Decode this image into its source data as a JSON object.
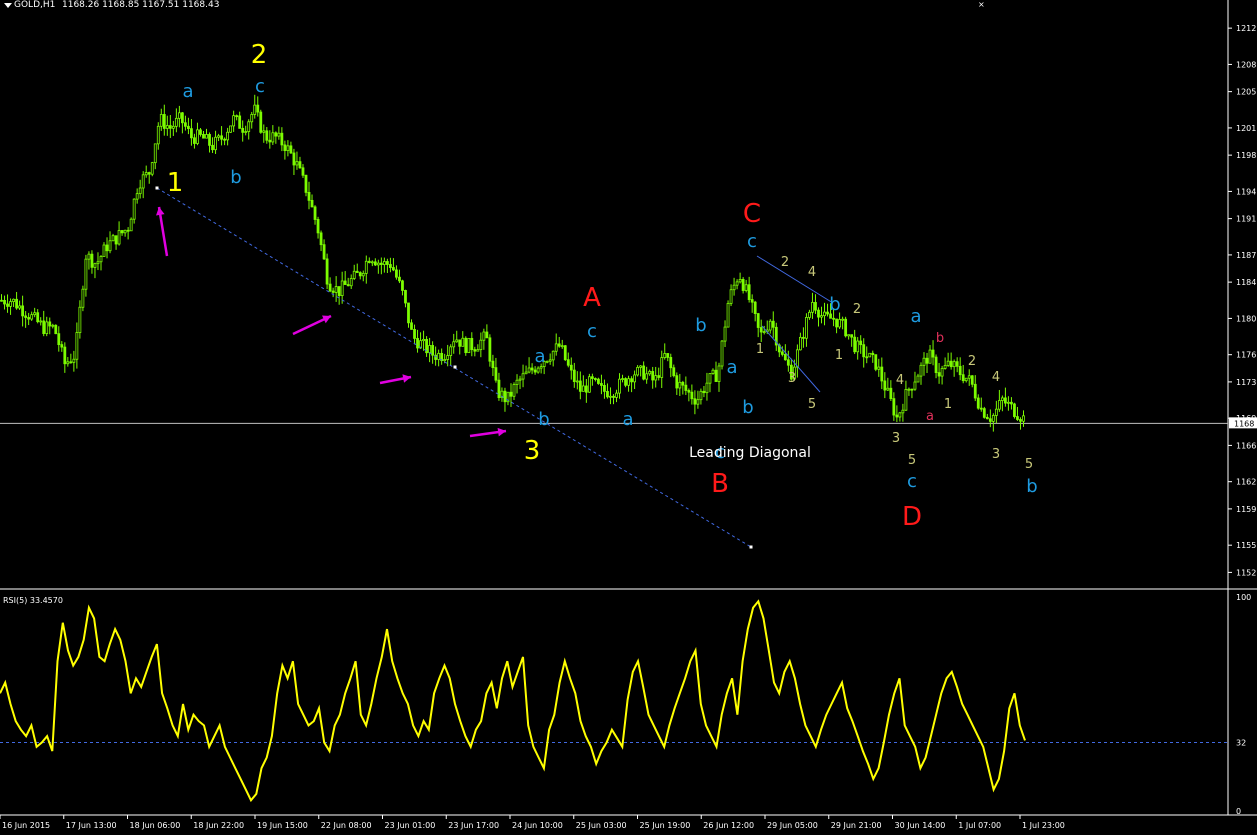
{
  "header": {
    "symbol": "GOLD,H1",
    "ohlc": "1168.26 1168.85 1167.51 1168.43",
    "close_glyph": "×"
  },
  "colors": {
    "background": "#000000",
    "candles": "#7CFC00",
    "rsi_line": "#FFFF00",
    "current_price_line": "#C0C0C0",
    "trendline": "#4169E1",
    "arrows": "#E000E0",
    "label_yellow": "#FFFF00",
    "label_cyan": "#1E9BE0",
    "label_red": "#FF1A1A",
    "label_olive": "#C8C87A",
    "label_pink": "#E0305A",
    "label_white": "#FFFFFF"
  },
  "price_axis": {
    "ticks": [
      "1212",
      "1208",
      "1205",
      "1201",
      "1198",
      "1194",
      "1191",
      "1187",
      "1184",
      "1180",
      "1176",
      "1173",
      "1169",
      "1166",
      "1162",
      "1159",
      "1155",
      "1152"
    ],
    "current_price": "1168"
  },
  "time_axis": {
    "labels": [
      "16 Jun 2015",
      "17 Jun 13:00",
      "18 Jun 06:00",
      "18 Jun 22:00",
      "19 Jun 15:00",
      "22 Jun 08:00",
      "23 Jun 01:00",
      "23 Jun 17:00",
      "24 Jun 10:00",
      "25 Jun 03:00",
      "25 Jun 19:00",
      "26 Jun 12:00",
      "29 Jun 05:00",
      "29 Jun 21:00",
      "30 Jun 14:00",
      "1 Jul 07:00",
      "1 Jul 23:00"
    ]
  },
  "rsi": {
    "label": "RSI(5) 33.4570",
    "ticks": [
      "100",
      "32",
      "0"
    ],
    "level": 32
  },
  "annotations": {
    "wave_labels": [
      {
        "t": "2",
        "c": "yellow",
        "s": "big"
      },
      {
        "t": "1",
        "c": "yellow",
        "s": "big"
      },
      {
        "t": "3",
        "c": "yellow",
        "s": "big"
      },
      {
        "t": "a",
        "c": "cyan",
        "s": "mid"
      },
      {
        "t": "c",
        "c": "cyan",
        "s": "mid"
      },
      {
        "t": "b",
        "c": "cyan",
        "s": "mid"
      },
      {
        "t": "A",
        "c": "red",
        "s": "big"
      },
      {
        "t": "c",
        "c": "cyan",
        "s": "mid"
      },
      {
        "t": "a",
        "c": "cyan",
        "s": "mid"
      },
      {
        "t": "b",
        "c": "cyan",
        "s": "mid"
      },
      {
        "t": "a",
        "c": "cyan",
        "s": "mid"
      },
      {
        "t": "b",
        "c": "cyan",
        "s": "mid"
      },
      {
        "t": "a",
        "c": "cyan",
        "s": "mid"
      },
      {
        "t": "b",
        "c": "cyan",
        "s": "mid"
      },
      {
        "t": "c",
        "c": "cyan",
        "s": "mid"
      },
      {
        "t": "B",
        "c": "red",
        "s": "big"
      },
      {
        "t": "C",
        "c": "red",
        "s": "big"
      },
      {
        "t": "c",
        "c": "cyan",
        "s": "mid"
      },
      {
        "t": "b",
        "c": "cyan",
        "s": "mid"
      },
      {
        "t": "2",
        "c": "olive",
        "s": "small"
      },
      {
        "t": "4",
        "c": "olive",
        "s": "small"
      },
      {
        "t": "2",
        "c": "olive",
        "s": "small"
      },
      {
        "t": "1",
        "c": "olive",
        "s": "small"
      },
      {
        "t": "3",
        "c": "olive",
        "s": "small"
      },
      {
        "t": "5",
        "c": "olive",
        "s": "small"
      },
      {
        "t": "1",
        "c": "olive",
        "s": "small"
      },
      {
        "t": "Leading Diagonal",
        "c": "white",
        "s": "text"
      },
      {
        "t": "a",
        "c": "cyan",
        "s": "mid"
      },
      {
        "t": "b",
        "c": "pink",
        "s": "small"
      },
      {
        "t": "a",
        "c": "pink",
        "s": "small"
      },
      {
        "t": "4",
        "c": "olive",
        "s": "small"
      },
      {
        "t": "3",
        "c": "olive",
        "s": "small"
      },
      {
        "t": "5",
        "c": "olive",
        "s": "small"
      },
      {
        "t": "c",
        "c": "cyan",
        "s": "mid"
      },
      {
        "t": "D",
        "c": "red",
        "s": "big"
      },
      {
        "t": "1",
        "c": "olive",
        "s": "small"
      },
      {
        "t": "2",
        "c": "olive",
        "s": "small"
      },
      {
        "t": "4",
        "c": "olive",
        "s": "small"
      },
      {
        "t": "3",
        "c": "olive",
        "s": "small"
      },
      {
        "t": "5",
        "c": "olive",
        "s": "small"
      },
      {
        "t": "b",
        "c": "cyan",
        "s": "mid"
      }
    ]
  },
  "chart_data": [
    {
      "type": "candlestick",
      "title": "GOLD,H1",
      "ylim": [
        1150.5,
        1214
      ],
      "current_price": 1168.43,
      "x": [
        "16 Jun 2015",
        "17 Jun 13:00",
        "18 Jun 06:00",
        "18 Jun 22:00",
        "19 Jun 15:00",
        "22 Jun 08:00",
        "23 Jun 01:00",
        "23 Jun 17:00",
        "24 Jun 10:00",
        "25 Jun 03:00",
        "25 Jun 19:00",
        "26 Jun 12:00",
        "29 Jun 05:00",
        "29 Jun 21:00",
        "30 Jun 14:00",
        "1 Jul 07:00",
        "1 Jul 23:00"
      ],
      "close_path": [
        1182,
        1182,
        1181,
        1180,
        1179,
        1179,
        1175,
        1176,
        1187,
        1186,
        1188,
        1189,
        1190,
        1195,
        1196,
        1202,
        1201,
        1202,
        1200,
        1200,
        1199,
        1200,
        1202,
        1201,
        1203,
        1200,
        1200,
        1199,
        1197,
        1194,
        1190,
        1184,
        1183,
        1184,
        1185,
        1187,
        1186,
        1186,
        1183,
        1178,
        1177,
        1176,
        1176,
        1178,
        1177,
        1177,
        1178,
        1172,
        1171,
        1173,
        1174,
        1175,
        1176,
        1177,
        1174,
        1172,
        1173,
        1172,
        1172,
        1173,
        1174,
        1174,
        1173,
        1176,
        1173,
        1172,
        1171,
        1173,
        1174,
        1182,
        1185,
        1182,
        1178,
        1180,
        1176,
        1174,
        1178,
        1182,
        1180,
        1180,
        1179,
        1177,
        1176,
        1175,
        1172,
        1169,
        1172,
        1174,
        1176,
        1174,
        1175,
        1174,
        1173,
        1170,
        1169,
        1171,
        1170,
        1169
      ]
    },
    {
      "type": "line",
      "title": "RSI(5) 33.4570",
      "ylim": [
        0,
        100
      ],
      "level": 32,
      "values": [
        55,
        60,
        50,
        42,
        38,
        35,
        40,
        30,
        32,
        35,
        28,
        70,
        88,
        75,
        68,
        72,
        80,
        95,
        90,
        72,
        70,
        78,
        85,
        80,
        70,
        55,
        62,
        58,
        65,
        72,
        78,
        55,
        48,
        40,
        35,
        50,
        38,
        45,
        42,
        40,
        30,
        35,
        40,
        30,
        25,
        20,
        15,
        10,
        5,
        8,
        20,
        25,
        35,
        55,
        68,
        62,
        70,
        50,
        45,
        40,
        42,
        48,
        32,
        28,
        40,
        45,
        55,
        62,
        70,
        45,
        40,
        50,
        62,
        72,
        85,
        70,
        62,
        55,
        50,
        40,
        35,
        42,
        38,
        55,
        62,
        68,
        62,
        50,
        42,
        35,
        30,
        38,
        42,
        55,
        60,
        48,
        62,
        70,
        58,
        65,
        72,
        40,
        30,
        25,
        20,
        38,
        45,
        60,
        70,
        62,
        55,
        42,
        35,
        30,
        22,
        28,
        32,
        38,
        34,
        30,
        52,
        65,
        70,
        58,
        45,
        40,
        35,
        30,
        40,
        48,
        55,
        62,
        70,
        75,
        50,
        40,
        35,
        30,
        45,
        55,
        62,
        45,
        70,
        85,
        95,
        98,
        90,
        75,
        60,
        55,
        65,
        70,
        62,
        50,
        40,
        35,
        30,
        38,
        45,
        50,
        55,
        60,
        48,
        42,
        35,
        28,
        22,
        15,
        20,
        32,
        45,
        55,
        62,
        40,
        35,
        30,
        20,
        25,
        35,
        45,
        55,
        62,
        65,
        58,
        50,
        45,
        40,
        35,
        30,
        20,
        10,
        15,
        28,
        48,
        55,
        40,
        33
      ]
    }
  ]
}
